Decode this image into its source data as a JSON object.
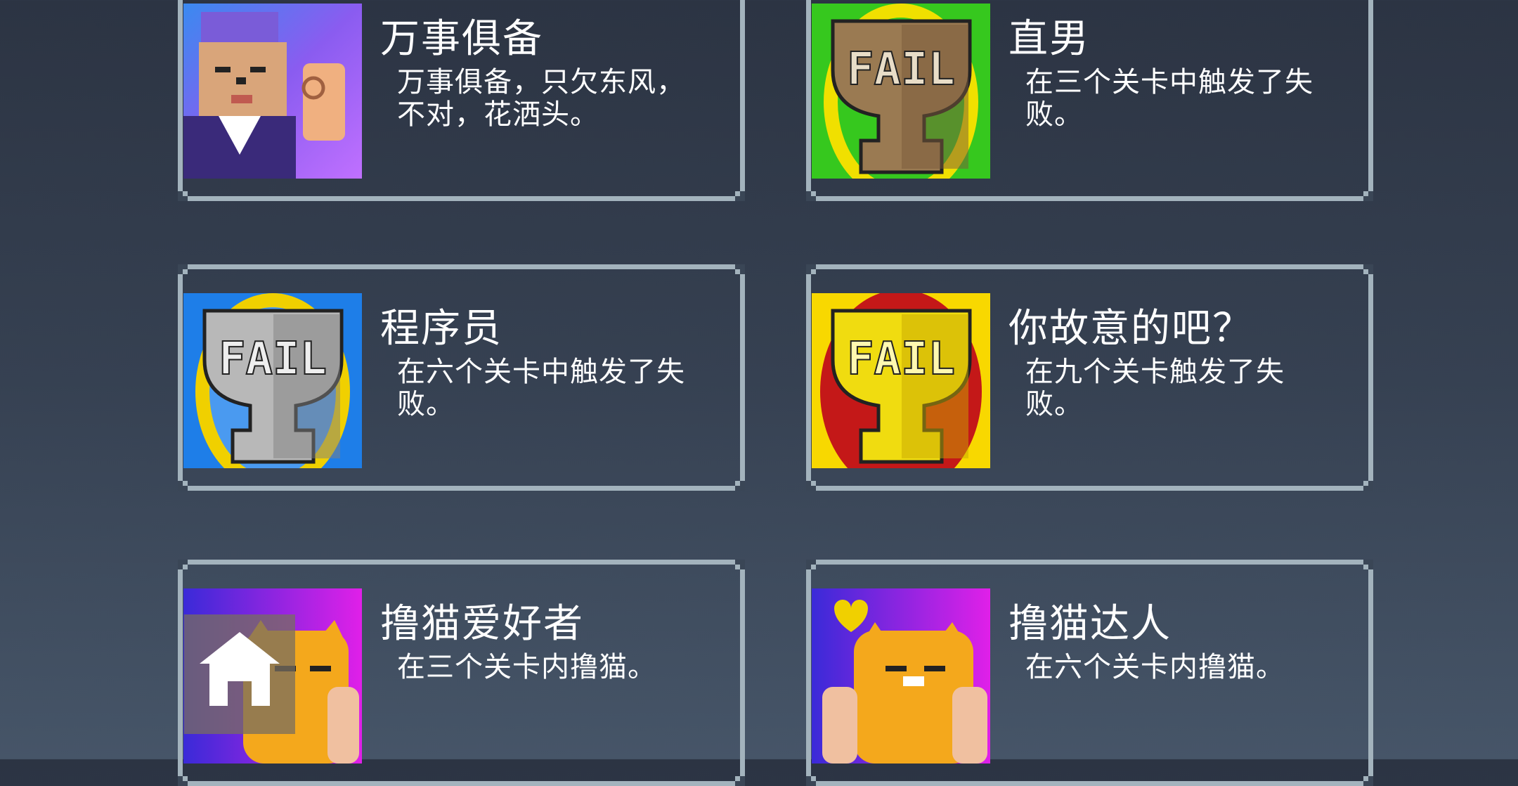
{
  "achievements": [
    {
      "title": "万事俱备",
      "desc": "万事俱备，只欠东风，不对，花洒头。",
      "icon": "old-man-ok-gesture-icon",
      "bg": [
        "#7a5cf0",
        "#b070ff"
      ]
    },
    {
      "title": "直男",
      "desc": "在三个关卡中触发了失败。",
      "icon": "bronze-fail-trophy-icon",
      "bg": [
        "#36c81e",
        "#f0e000"
      ]
    },
    {
      "title": "程序员",
      "desc": "在六个关卡中触发了失败。",
      "icon": "silver-fail-trophy-icon",
      "bg": [
        "#1e7ee8",
        "#f0d000"
      ]
    },
    {
      "title": "你故意的吧？",
      "desc": "在九个关卡触发了失败。",
      "icon": "gold-fail-trophy-icon",
      "bg": [
        "#c41818",
        "#f8d800"
      ]
    },
    {
      "title": "撸猫爱好者",
      "desc": "在三个关卡内撸猫。",
      "icon": "petting-cat-icon",
      "bg": [
        "#5a2ad8",
        "#e020e8"
      ]
    },
    {
      "title": "撸猫达人",
      "desc": "在六个关卡内撸猫。",
      "icon": "petting-cat-heart-icon",
      "bg": [
        "#5a2ad8",
        "#e020e8"
      ]
    }
  ],
  "fail_text": "FAIL",
  "colors": {
    "frame": "#a3b3bd",
    "bronze": "#9a7a52",
    "silver": "#a8a8a8",
    "gold": "#e8d410",
    "cat": "#f4a81c"
  }
}
